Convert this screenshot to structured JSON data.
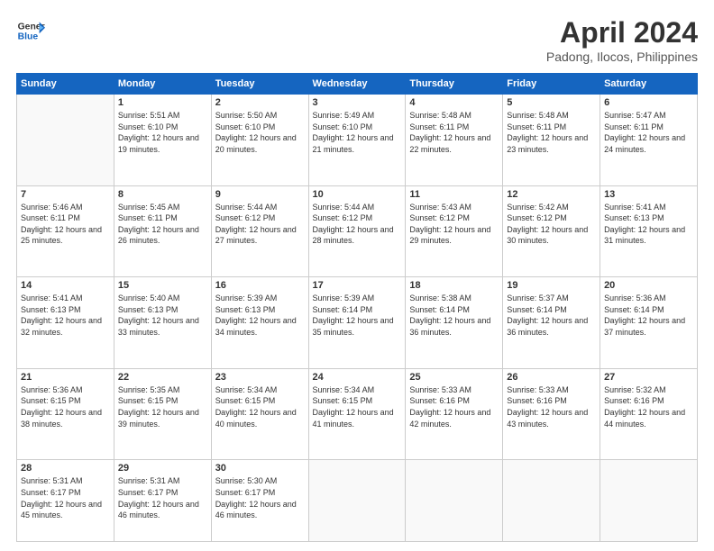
{
  "header": {
    "logo_line1": "General",
    "logo_line2": "Blue",
    "month": "April 2024",
    "location": "Padong, Ilocos, Philippines"
  },
  "weekdays": [
    "Sunday",
    "Monday",
    "Tuesday",
    "Wednesday",
    "Thursday",
    "Friday",
    "Saturday"
  ],
  "weeks": [
    [
      {
        "day": "",
        "info": ""
      },
      {
        "day": "1",
        "info": "Sunrise: 5:51 AM\nSunset: 6:10 PM\nDaylight: 12 hours\nand 19 minutes."
      },
      {
        "day": "2",
        "info": "Sunrise: 5:50 AM\nSunset: 6:10 PM\nDaylight: 12 hours\nand 20 minutes."
      },
      {
        "day": "3",
        "info": "Sunrise: 5:49 AM\nSunset: 6:10 PM\nDaylight: 12 hours\nand 21 minutes."
      },
      {
        "day": "4",
        "info": "Sunrise: 5:48 AM\nSunset: 6:11 PM\nDaylight: 12 hours\nand 22 minutes."
      },
      {
        "day": "5",
        "info": "Sunrise: 5:48 AM\nSunset: 6:11 PM\nDaylight: 12 hours\nand 23 minutes."
      },
      {
        "day": "6",
        "info": "Sunrise: 5:47 AM\nSunset: 6:11 PM\nDaylight: 12 hours\nand 24 minutes."
      }
    ],
    [
      {
        "day": "7",
        "info": "Sunrise: 5:46 AM\nSunset: 6:11 PM\nDaylight: 12 hours\nand 25 minutes."
      },
      {
        "day": "8",
        "info": "Sunrise: 5:45 AM\nSunset: 6:11 PM\nDaylight: 12 hours\nand 26 minutes."
      },
      {
        "day": "9",
        "info": "Sunrise: 5:44 AM\nSunset: 6:12 PM\nDaylight: 12 hours\nand 27 minutes."
      },
      {
        "day": "10",
        "info": "Sunrise: 5:44 AM\nSunset: 6:12 PM\nDaylight: 12 hours\nand 28 minutes."
      },
      {
        "day": "11",
        "info": "Sunrise: 5:43 AM\nSunset: 6:12 PM\nDaylight: 12 hours\nand 29 minutes."
      },
      {
        "day": "12",
        "info": "Sunrise: 5:42 AM\nSunset: 6:12 PM\nDaylight: 12 hours\nand 30 minutes."
      },
      {
        "day": "13",
        "info": "Sunrise: 5:41 AM\nSunset: 6:13 PM\nDaylight: 12 hours\nand 31 minutes."
      }
    ],
    [
      {
        "day": "14",
        "info": "Sunrise: 5:41 AM\nSunset: 6:13 PM\nDaylight: 12 hours\nand 32 minutes."
      },
      {
        "day": "15",
        "info": "Sunrise: 5:40 AM\nSunset: 6:13 PM\nDaylight: 12 hours\nand 33 minutes."
      },
      {
        "day": "16",
        "info": "Sunrise: 5:39 AM\nSunset: 6:13 PM\nDaylight: 12 hours\nand 34 minutes."
      },
      {
        "day": "17",
        "info": "Sunrise: 5:39 AM\nSunset: 6:14 PM\nDaylight: 12 hours\nand 35 minutes."
      },
      {
        "day": "18",
        "info": "Sunrise: 5:38 AM\nSunset: 6:14 PM\nDaylight: 12 hours\nand 36 minutes."
      },
      {
        "day": "19",
        "info": "Sunrise: 5:37 AM\nSunset: 6:14 PM\nDaylight: 12 hours\nand 36 minutes."
      },
      {
        "day": "20",
        "info": "Sunrise: 5:36 AM\nSunset: 6:14 PM\nDaylight: 12 hours\nand 37 minutes."
      }
    ],
    [
      {
        "day": "21",
        "info": "Sunrise: 5:36 AM\nSunset: 6:15 PM\nDaylight: 12 hours\nand 38 minutes."
      },
      {
        "day": "22",
        "info": "Sunrise: 5:35 AM\nSunset: 6:15 PM\nDaylight: 12 hours\nand 39 minutes."
      },
      {
        "day": "23",
        "info": "Sunrise: 5:34 AM\nSunset: 6:15 PM\nDaylight: 12 hours\nand 40 minutes."
      },
      {
        "day": "24",
        "info": "Sunrise: 5:34 AM\nSunset: 6:15 PM\nDaylight: 12 hours\nand 41 minutes."
      },
      {
        "day": "25",
        "info": "Sunrise: 5:33 AM\nSunset: 6:16 PM\nDaylight: 12 hours\nand 42 minutes."
      },
      {
        "day": "26",
        "info": "Sunrise: 5:33 AM\nSunset: 6:16 PM\nDaylight: 12 hours\nand 43 minutes."
      },
      {
        "day": "27",
        "info": "Sunrise: 5:32 AM\nSunset: 6:16 PM\nDaylight: 12 hours\nand 44 minutes."
      }
    ],
    [
      {
        "day": "28",
        "info": "Sunrise: 5:31 AM\nSunset: 6:17 PM\nDaylight: 12 hours\nand 45 minutes."
      },
      {
        "day": "29",
        "info": "Sunrise: 5:31 AM\nSunset: 6:17 PM\nDaylight: 12 hours\nand 46 minutes."
      },
      {
        "day": "30",
        "info": "Sunrise: 5:30 AM\nSunset: 6:17 PM\nDaylight: 12 hours\nand 46 minutes."
      },
      {
        "day": "",
        "info": ""
      },
      {
        "day": "",
        "info": ""
      },
      {
        "day": "",
        "info": ""
      },
      {
        "day": "",
        "info": ""
      }
    ]
  ]
}
